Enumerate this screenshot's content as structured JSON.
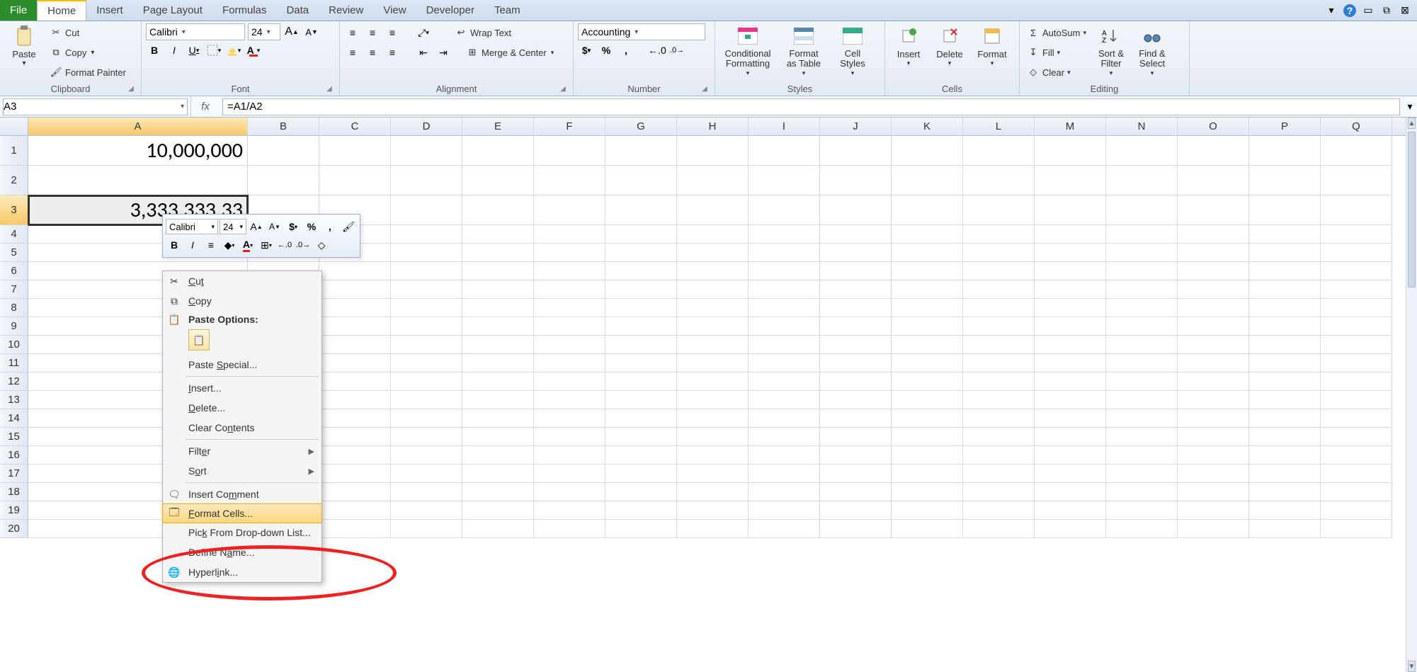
{
  "tabs": {
    "file": "File",
    "home": "Home",
    "insert": "Insert",
    "page_layout": "Page Layout",
    "formulas": "Formulas",
    "data": "Data",
    "review": "Review",
    "view": "View",
    "developer": "Developer",
    "team": "Team"
  },
  "ribbon": {
    "clipboard": {
      "label": "Clipboard",
      "paste": "Paste",
      "cut": "Cut",
      "copy": "Copy",
      "format_painter": "Format Painter"
    },
    "font": {
      "label": "Font",
      "name": "Calibri",
      "size": "24",
      "bold": "B",
      "italic": "I",
      "underline": "U"
    },
    "alignment": {
      "label": "Alignment",
      "wrap_text": "Wrap Text",
      "merge_center": "Merge & Center"
    },
    "number": {
      "label": "Number",
      "format": "Accounting"
    },
    "styles": {
      "label": "Styles",
      "conditional": "Conditional\nFormatting",
      "as_table": "Format\nas Table",
      "cell_styles": "Cell\nStyles"
    },
    "cells": {
      "label": "Cells",
      "insert": "Insert",
      "delete": "Delete",
      "format": "Format"
    },
    "editing": {
      "label": "Editing",
      "autosum": "AutoSum",
      "fill": "Fill",
      "clear": "Clear",
      "sort": "Sort &\nFilter",
      "find": "Find &\nSelect"
    }
  },
  "namebox": "A3",
  "formula": "=A1/A2",
  "columns": [
    "A",
    "B",
    "C",
    "D",
    "E",
    "F",
    "G",
    "H",
    "I",
    "J",
    "K",
    "L",
    "M",
    "N",
    "O",
    "P",
    "Q"
  ],
  "col_widths": {
    "A": 310,
    "default": 101
  },
  "rows": [
    1,
    2,
    3,
    4,
    5,
    6,
    7,
    8,
    9,
    10,
    11,
    12,
    13,
    14,
    15,
    16,
    17,
    18,
    19,
    20
  ],
  "row_heights": {
    "1": 42,
    "2": 42,
    "3": 42,
    "default": 26
  },
  "cells": {
    "A1": "10,000,000",
    "A3": "3,333,333.33"
  },
  "selected_cell": "A3",
  "mini_toolbar": {
    "font": "Calibri",
    "size": "24"
  },
  "context_menu": {
    "cut": "Cut",
    "copy": "Copy",
    "paste_options": "Paste Options:",
    "paste_special": "Paste Special...",
    "insert": "Insert...",
    "delete": "Delete...",
    "clear_contents": "Clear Contents",
    "filter": "Filter",
    "sort": "Sort",
    "insert_comment": "Insert Comment",
    "format_cells": "Format Cells...",
    "pick_from_list": "Pick From Drop-down List...",
    "define_name": "Define Name...",
    "hyperlink": "Hyperlink..."
  },
  "sigma": "Σ"
}
